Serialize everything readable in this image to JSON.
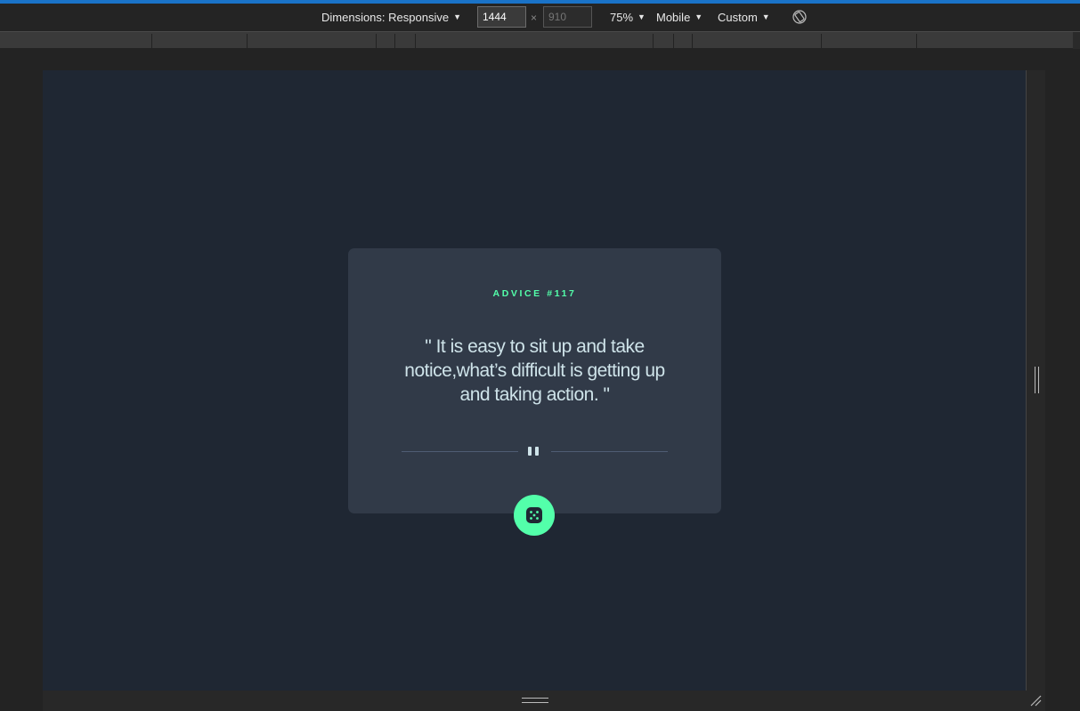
{
  "devtools": {
    "dimensions_label": "Dimensions: Responsive",
    "width_value": "1444",
    "height_placeholder": "910",
    "times": "×",
    "zoom": "75%",
    "device_mode": "Mobile",
    "throttling": "Custom",
    "icons": {
      "rotate": "rotate-icon",
      "caret": "▼"
    }
  },
  "app": {
    "advice_label": "ADVICE #117",
    "advice_quote": "\" It is easy to sit up and take notice,what’s difficult is getting up and taking action. \"",
    "dice_button_icon": "dice-icon",
    "colors": {
      "accent": "#53ffaa",
      "card_bg": "#313a48",
      "page_bg": "#1f2733",
      "quote_text": "#cee3e9"
    }
  }
}
